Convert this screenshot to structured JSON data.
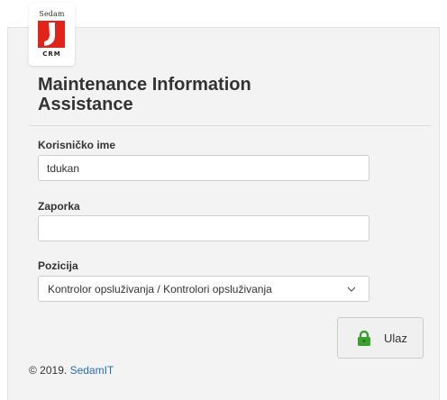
{
  "logo": {
    "top_text": "Sedam",
    "bottom_text": "CRM"
  },
  "title": "Maintenance Information Assistance",
  "username": {
    "label": "Korisničko ime",
    "value": "tdukan"
  },
  "password": {
    "label": "Zaporka",
    "value": ""
  },
  "position": {
    "label": "Pozicija",
    "selected": "Kontrolor opsluživanja / Kontrolori opsluživanja"
  },
  "login_button": {
    "label": "Ulaz",
    "icon": "lock-icon"
  },
  "footer": {
    "copyright": "© 2019.",
    "link": "SedamIT"
  },
  "colors": {
    "brand_red": "#e2231a",
    "lock_green": "#3aa12e",
    "link_blue": "#2a6ebb"
  }
}
